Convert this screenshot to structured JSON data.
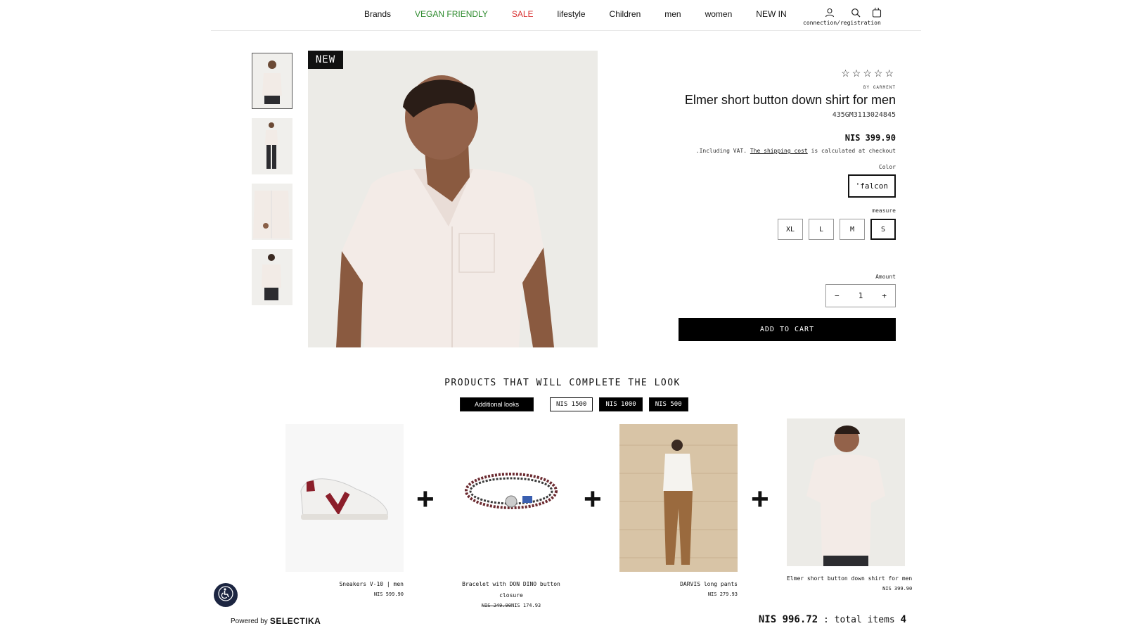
{
  "nav": {
    "links": [
      "Brands",
      "VEGAN FRIENDLY",
      "SALE",
      "lifestyle",
      "Children",
      "men",
      "women",
      "NEW IN"
    ],
    "account_label": "connection/registration",
    "icons": [
      "user-icon",
      "search-icon",
      "cart-icon"
    ]
  },
  "gallery": {
    "badge": "NEW"
  },
  "product": {
    "stars": "☆☆☆☆☆",
    "brand": "BY GARMENT",
    "title": "Elmer short button down shirt for men",
    "sku": "435GM3113024845",
    "price": "NIS 399.90",
    "vat_prefix": ".Including VAT.",
    "vat_link": "The shipping cost",
    "vat_suffix": "is calculated at checkout",
    "color_label": "Color",
    "color_value": "'falcon",
    "size_label": "measure",
    "sizes": [
      "XL",
      "L",
      "M",
      "S"
    ],
    "selected_size": "S",
    "amount_label": "Amount",
    "qty_minus": "−",
    "qty_value": "1",
    "qty_plus": "+",
    "add_to_cart": "ADD TO CART"
  },
  "complete_look": {
    "title": "PRODUCTS THAT WILL COMPLETE THE LOOK",
    "filters": [
      "Additional looks",
      "NIS 1500",
      "NIS 1000",
      "NIS 500"
    ],
    "products": [
      {
        "name": "Sneakers V-10 | men",
        "price": "NIS 599.90",
        "old_price": ""
      },
      {
        "name": "Bracelet with DON DINO button closure",
        "price": "NIS 174.93",
        "old_price": "NIS 249.90"
      },
      {
        "name": "DARVIS long pants",
        "price": "NIS 279.93",
        "old_price": ""
      },
      {
        "name": "Elmer short button down shirt for men",
        "price": "NIS 399.90",
        "old_price": ""
      }
    ],
    "plus_sign": "+",
    "total_price": "NIS 996.72",
    "total_label": ": total  items",
    "total_items": "4",
    "powered_by": "Powered by",
    "powered_brand": "SELECTIKA"
  },
  "colors": {
    "accent_green": "#2e8b2e",
    "accent_red": "#d93434",
    "button_black": "#000000",
    "a11y_badge": "#1c2541"
  }
}
